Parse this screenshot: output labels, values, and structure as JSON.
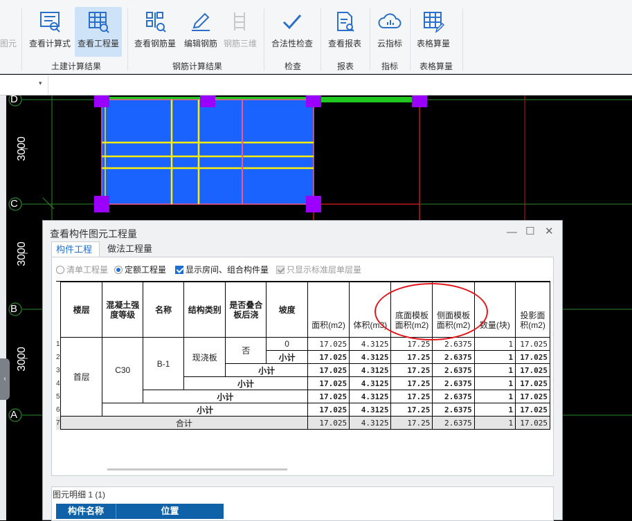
{
  "ribbon": {
    "cut_left": "图元",
    "buttons": [
      {
        "id": "view-formula",
        "label": "查看计算式",
        "active": false,
        "disabled": false
      },
      {
        "id": "view-quantity",
        "label": "查看工程量",
        "active": true,
        "disabled": false
      },
      {
        "id": "view-rebar",
        "label": "查看钢筋量",
        "active": false,
        "disabled": false
      },
      {
        "id": "edit-rebar",
        "label": "编辑钢筋",
        "active": false,
        "disabled": false
      },
      {
        "id": "rebar-3d",
        "label": "钢筋三维",
        "active": false,
        "disabled": true
      },
      {
        "id": "legality-check",
        "label": "合法性检查",
        "active": false,
        "disabled": false
      },
      {
        "id": "view-report",
        "label": "查看报表",
        "active": false,
        "disabled": false
      },
      {
        "id": "cloud-index",
        "label": "云指标",
        "active": false,
        "disabled": false
      },
      {
        "id": "table-calc",
        "label": "表格算量",
        "active": false,
        "disabled": false
      }
    ],
    "groups": [
      "土建计算结果",
      "钢筋计算结果",
      "检查",
      "报表",
      "指标",
      "表格算量"
    ]
  },
  "canvas": {
    "axis_labels": [
      "D",
      "C",
      "B",
      "A"
    ],
    "dimensions": [
      "3000",
      "3000",
      "3000"
    ]
  },
  "dialog": {
    "title": "查看构件图元工程量",
    "tabs": [
      "构件工程量",
      "做法工程量"
    ],
    "options": {
      "list_quantity": "清单工程量",
      "quota_quantity": "定额工程量",
      "show_rooms": "显示房间、组合构件量",
      "only_standard": "只显示标准层单层量"
    },
    "table": {
      "headers": [
        "楼层",
        "混凝土强度等级",
        "名称",
        "结构类别",
        "是否叠合板后浇",
        "坡度",
        "面积(m2)",
        "体积(m3)",
        "底面模板面积(m2)",
        "侧面模板面积(m2)",
        "数量(块)",
        "投影面积(m2)"
      ],
      "row_numbers": [
        "1",
        "2",
        "3",
        "4",
        "5",
        "6",
        "7"
      ],
      "floor": "首层",
      "grade": "C30",
      "name": "B-1",
      "struct": "现浇板",
      "laminated": "否",
      "slope": "0",
      "subtotal": "小计",
      "total": "合计",
      "values": {
        "area": "17.025",
        "volume": "4.3125",
        "bottom": "17.25",
        "side": "2.6375",
        "count": "1",
        "proj": "17.025"
      }
    },
    "detail": {
      "title": "图元明细  1 (1)",
      "col1": "构件名称",
      "col2": "位置"
    }
  },
  "colors": {
    "slab": "#1a63ff",
    "rebar": "#ffee00",
    "column": "#9b00ff",
    "annotation": "#e3141b",
    "accent": "#1f6fd1"
  }
}
